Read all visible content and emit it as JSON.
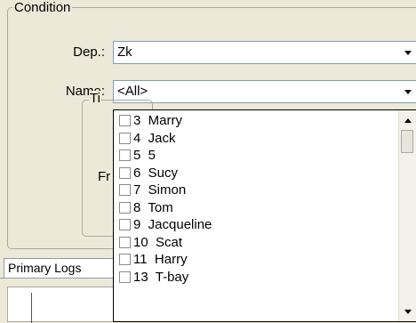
{
  "condition": {
    "group_title": "Condition",
    "dep_label": "Dep.:",
    "dep_value": "Zk",
    "name_label": "Name:",
    "name_value": "<All>",
    "inner_title": "Ti",
    "inner_label": "Fr"
  },
  "tabs": [
    {
      "label": "Primary Logs"
    }
  ],
  "dropdown": {
    "items": [
      {
        "label": "3  Marry",
        "checked": false
      },
      {
        "label": "4  Jack",
        "checked": false
      },
      {
        "label": "5  5",
        "checked": false
      },
      {
        "label": "6  Sucy",
        "checked": false
      },
      {
        "label": "7  Simon",
        "checked": false
      },
      {
        "label": "8  Tom",
        "checked": false
      },
      {
        "label": "9  Jacqueline",
        "checked": false
      },
      {
        "label": "10  Scat",
        "checked": false
      },
      {
        "label": "11  Harry",
        "checked": false
      },
      {
        "label": "13  T-bay",
        "checked": false
      }
    ]
  },
  "icons": {
    "dropdown_arrow": "chevron-down-icon",
    "scroll_up": "scroll-up-icon",
    "scroll_down": "scroll-down-icon"
  },
  "colors": {
    "window_bg": "#ece9d8",
    "field_border": "#7f9db9",
    "list_bg": "#ffffff"
  }
}
